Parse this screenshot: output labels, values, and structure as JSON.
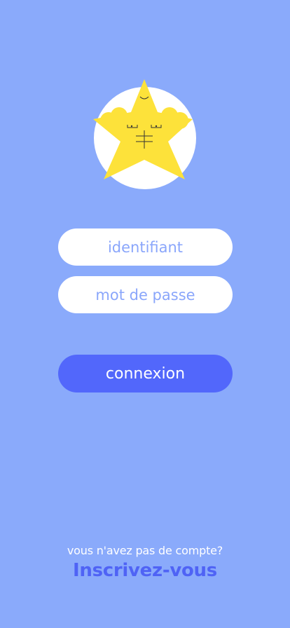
{
  "logo": {
    "icon": "starfish-mascot-icon",
    "star_color": "#fde23a",
    "circle_color": "#ffffff"
  },
  "login_form": {
    "username_placeholder": "identifiant",
    "username_value": "",
    "password_placeholder": "mot de passe",
    "password_value": "",
    "submit_label": "connexion"
  },
  "signup": {
    "prompt": "vous n'avez pas de compte?",
    "link_label": "Inscrivez-vous"
  },
  "colors": {
    "background": "#8aaafb",
    "primary_button": "#5267fb",
    "link": "#4f63f5",
    "placeholder": "#8aa6fb"
  }
}
